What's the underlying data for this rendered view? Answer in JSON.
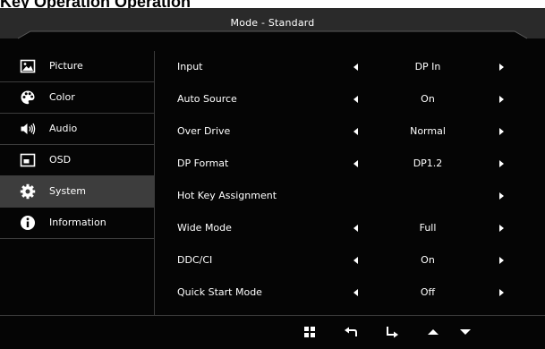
{
  "page_heading": "Key Operation Operation",
  "title": "Mode - Standard",
  "sidebar": {
    "items": [
      {
        "label": "Picture",
        "icon": "picture-icon",
        "active": false
      },
      {
        "label": "Color",
        "icon": "palette-icon",
        "active": false
      },
      {
        "label": "Audio",
        "icon": "speaker-icon",
        "active": false
      },
      {
        "label": "OSD",
        "icon": "osd-icon",
        "active": false
      },
      {
        "label": "System",
        "icon": "gear-icon",
        "active": true
      },
      {
        "label": "Information",
        "icon": "info-icon",
        "active": false
      }
    ]
  },
  "settings": [
    {
      "label": "Input",
      "value": "DP In"
    },
    {
      "label": "Auto Source",
      "value": "On"
    },
    {
      "label": "Over Drive",
      "value": "Normal"
    },
    {
      "label": "DP Format",
      "value": "DP1.2"
    },
    {
      "label": "Hot Key Assignment",
      "value": ""
    },
    {
      "label": "Wide Mode",
      "value": "Full"
    },
    {
      "label": "DDC/CI",
      "value": "On"
    },
    {
      "label": "Quick Start Mode",
      "value": "Off"
    }
  ],
  "bottom_keys": [
    "menu-grid-icon",
    "return-icon",
    "enter-icon",
    "up-arrow-icon",
    "down-arrow-icon"
  ],
  "colors": {
    "background": "#050505",
    "title_bar": "#2a2a2a",
    "active_item": "#3d3d3d",
    "divider": "#3c3c3c",
    "text": "#ffffff"
  }
}
